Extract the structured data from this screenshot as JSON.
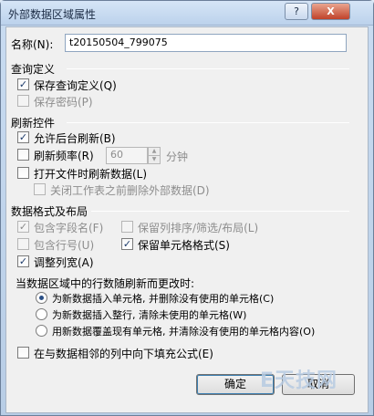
{
  "window": {
    "title": "外部数据区域属性",
    "help_label": "?",
    "close_label": "X"
  },
  "name": {
    "label": "名称(N):",
    "value": "t20150504_799075"
  },
  "query_def": {
    "title": "查询定义",
    "save_query": {
      "label": "保存查询定义(Q)",
      "checked": true
    },
    "save_password": {
      "label": "保存密码(P)",
      "checked": false
    }
  },
  "refresh": {
    "title": "刷新控件",
    "background": {
      "label": "允许后台刷新(B)",
      "checked": true
    },
    "frequency": {
      "label": "刷新频率(R)",
      "value": "60",
      "unit": "分钟",
      "checked": false
    },
    "on_open": {
      "label": "打开文件时刷新数据(L)",
      "checked": false
    },
    "remove_data": {
      "label": "关闭工作表之前删除外部数据(D)",
      "checked": false
    }
  },
  "format": {
    "title": "数据格式及布局",
    "include_field_names": {
      "label": "包含字段名(F)",
      "checked": true
    },
    "preserve_sort": {
      "label": "保留列排序/筛选/布局(L)",
      "checked": false
    },
    "include_row_numbers": {
      "label": "包含行号(U)",
      "checked": false
    },
    "preserve_cell_format": {
      "label": "保留单元格格式(S)",
      "checked": true
    },
    "adjust_column_width": {
      "label": "调整列宽(A)",
      "checked": true
    }
  },
  "row_change": {
    "title": "当数据区域中的行数随刷新而更改时:",
    "options": [
      {
        "label": "为新数据插入单元格, 并删除没有使用的单元格(C)",
        "selected": true
      },
      {
        "label": "为新数据插入整行, 清除未使用的单元格(W)",
        "selected": false
      },
      {
        "label": "用新数据覆盖现有单元格, 并清除没有使用的单元格内容(O)",
        "selected": false
      }
    ]
  },
  "fill_down": {
    "label": "在与数据相邻的列中向下填充公式(E)",
    "checked": false
  },
  "buttons": {
    "ok": "确定",
    "cancel": "取消"
  },
  "watermark": "E天技网"
}
